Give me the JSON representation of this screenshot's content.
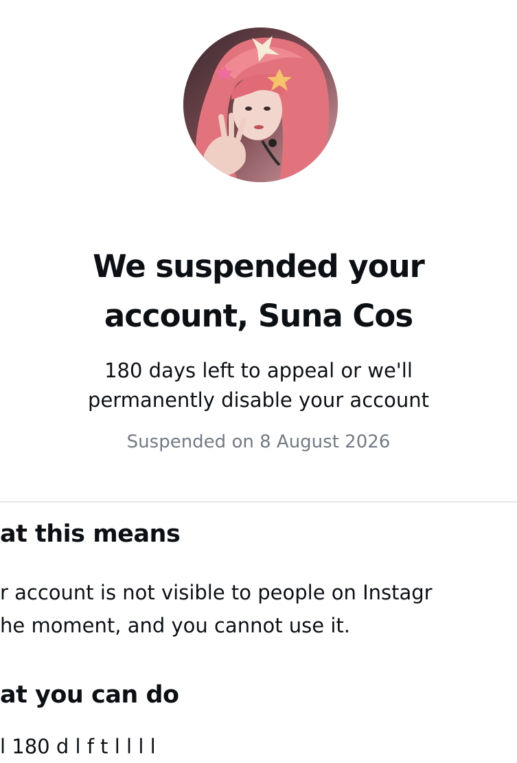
{
  "profile": {
    "avatar_icon": "profile-photo"
  },
  "headline": {
    "line1": "We suspended your",
    "line2": "account, Suna Cos"
  },
  "subtitle": {
    "line1": "180 days left to appeal or we'll",
    "line2": "permanently disable your account"
  },
  "suspended_date": "Suspended on 8 August 2026",
  "sections": [
    {
      "heading": "at this means",
      "body_line1": "r account is not visible to people on Instagr",
      "body_line2": "he moment, and you cannot use it."
    },
    {
      "heading": "at you can do",
      "body_line1": "l        180 d      l  f  t                    l       l  l       l"
    }
  ],
  "colors": {
    "text": "#0c1014",
    "muted": "#737a83",
    "divider": "#e4e6eb",
    "background": "#ffffff"
  }
}
